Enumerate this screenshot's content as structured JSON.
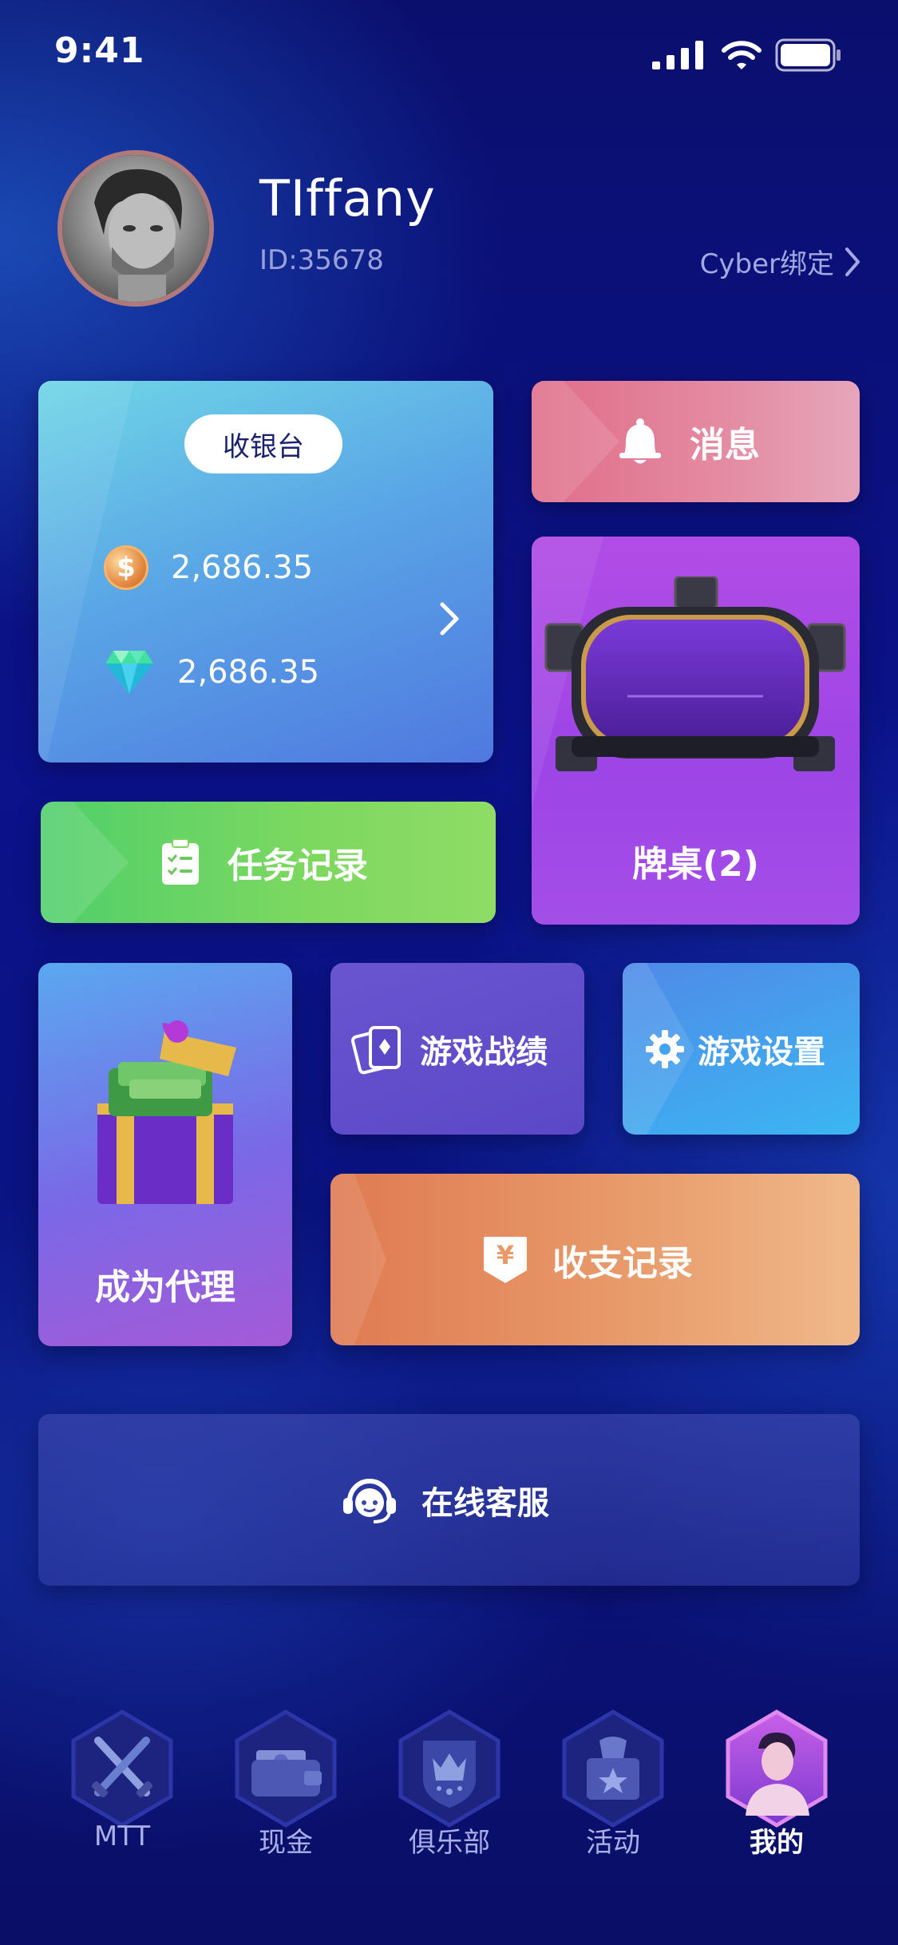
{
  "status_bar": {
    "time": "9:41"
  },
  "profile": {
    "name": "TIffany",
    "id_text": "ID:35678",
    "bind_link": "Cyber绑定"
  },
  "cashier": {
    "title": "收银台",
    "coin_balance": "2,686.35",
    "diamond_balance": "2,686.35",
    "coin_symbol": "$"
  },
  "tiles": {
    "messages": "消息",
    "tasks": "任务记录",
    "tables": "牌桌(2)",
    "agent": "成为代理",
    "game_record": "游戏战绩",
    "game_settings": "游戏设置",
    "income_record": "收支记录",
    "online_service": "在线客服"
  },
  "income_icon_char": "¥",
  "nav": {
    "items": [
      {
        "label": "MTT",
        "icon": "swords-icon",
        "active": false
      },
      {
        "label": "现金",
        "icon": "wallet-icon",
        "active": false
      },
      {
        "label": "俱乐部",
        "icon": "crown-shield-icon",
        "active": false
      },
      {
        "label": "活动",
        "icon": "gift-star-icon",
        "active": false
      },
      {
        "label": "我的",
        "icon": "user-avatar-icon",
        "active": true
      }
    ]
  },
  "colors": {
    "background": "#0b128a",
    "cashier": "#5aa6e6",
    "messages": "#e48ca3",
    "tables": "#a44ee8",
    "tasks": "#7ed860",
    "income": "#e89a6a",
    "settings": "#3bb6f2"
  }
}
